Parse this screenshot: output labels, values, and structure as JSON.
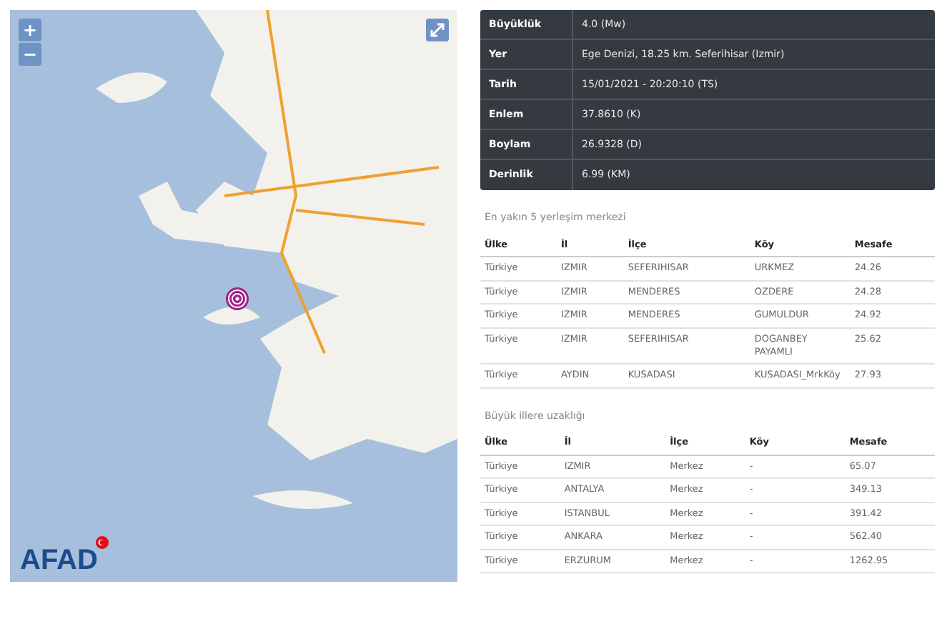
{
  "map": {
    "zoom_in": "+",
    "zoom_out": "−",
    "logo": "AFAD"
  },
  "details": [
    {
      "label": "Büyüklük",
      "value": "4.0 (Mw)"
    },
    {
      "label": "Yer",
      "value": "Ege Denizi, 18.25 km. Seferihisar (Izmir)"
    },
    {
      "label": "Tarih",
      "value": "15/01/2021 - 20:20:10 (TS)"
    },
    {
      "label": "Enlem",
      "value": "37.8610 (K)"
    },
    {
      "label": "Boylam",
      "value": "26.9328 (D)"
    },
    {
      "label": "Derinlik",
      "value": "6.99 (KM)"
    }
  ],
  "nearest": {
    "title": "En yakın 5 yerleşim merkezi",
    "columns": [
      "Ülke",
      "İl",
      "İlçe",
      "Köy",
      "Mesafe"
    ],
    "rows": [
      [
        "Türkiye",
        "IZMIR",
        "SEFERIHISAR",
        "URKMEZ",
        "24.26"
      ],
      [
        "Türkiye",
        "IZMIR",
        "MENDERES",
        "OZDERE",
        "24.28"
      ],
      [
        "Türkiye",
        "IZMIR",
        "MENDERES",
        "GUMULDUR",
        "24.92"
      ],
      [
        "Türkiye",
        "IZMIR",
        "SEFERIHISAR",
        "DOGANBEY PAYAMLI",
        "25.62"
      ],
      [
        "Türkiye",
        "AYDIN",
        "KUSADASI",
        "KUSADASI_MrkKöy",
        "27.93"
      ]
    ]
  },
  "cities": {
    "title": "Büyük illere uzaklığı",
    "columns": [
      "Ülke",
      "İl",
      "İlçe",
      "Köy",
      "Mesafe"
    ],
    "rows": [
      [
        "Türkiye",
        "IZMIR",
        "Merkez",
        "-",
        "65.07"
      ],
      [
        "Türkiye",
        "ANTALYA",
        "Merkez",
        "-",
        "349.13"
      ],
      [
        "Türkiye",
        "ISTANBUL",
        "Merkez",
        "-",
        "391.42"
      ],
      [
        "Türkiye",
        "ANKARA",
        "Merkez",
        "-",
        "562.40"
      ],
      [
        "Türkiye",
        "ERZURUM",
        "Merkez",
        "-",
        "1262.95"
      ]
    ]
  }
}
